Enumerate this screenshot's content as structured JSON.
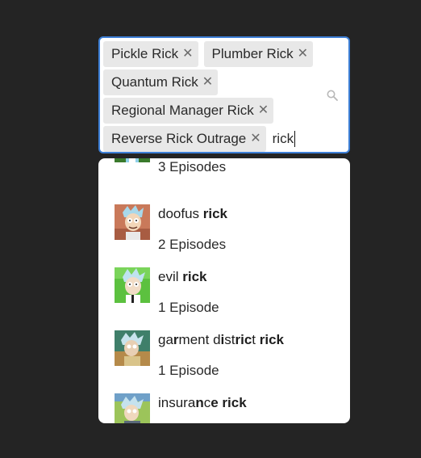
{
  "select": {
    "tags": [
      {
        "label": "Pickle Rick"
      },
      {
        "label": "Plumber Rick"
      },
      {
        "label": "Quantum Rick"
      },
      {
        "label": "Regional Manager Rick"
      },
      {
        "label": "Reverse Rick Outrage"
      }
    ],
    "remove_glyph": "✕",
    "query": "rick",
    "search_icon": "search-icon"
  },
  "options": [
    {
      "name_html": "",
      "count": "3 Episodes",
      "thumb": "rick-thumbnail-partial"
    },
    {
      "name_html": "doofus <b>rick</b>",
      "count": "2 Episodes",
      "thumb": "doofus-rick-thumbnail"
    },
    {
      "name_html": "evil <b>rick</b>",
      "count": "1 Episode",
      "thumb": "evil-rick-thumbnail"
    },
    {
      "name_html": "ga<b>r</b>ment d<b>i</b>st<b>ric</b>t <b>rick</b>",
      "count": "1 Episode",
      "thumb": "garment-district-rick-thumbnail"
    },
    {
      "name_html": "insura<b>n</b>c<b>e</b> <b>rick</b>",
      "count": "",
      "thumb": "insurance-rick-thumbnail"
    }
  ],
  "colors": {
    "background": "#242424",
    "focus_border": "#3d7fd6",
    "tag_bg": "#e8e8e8"
  }
}
